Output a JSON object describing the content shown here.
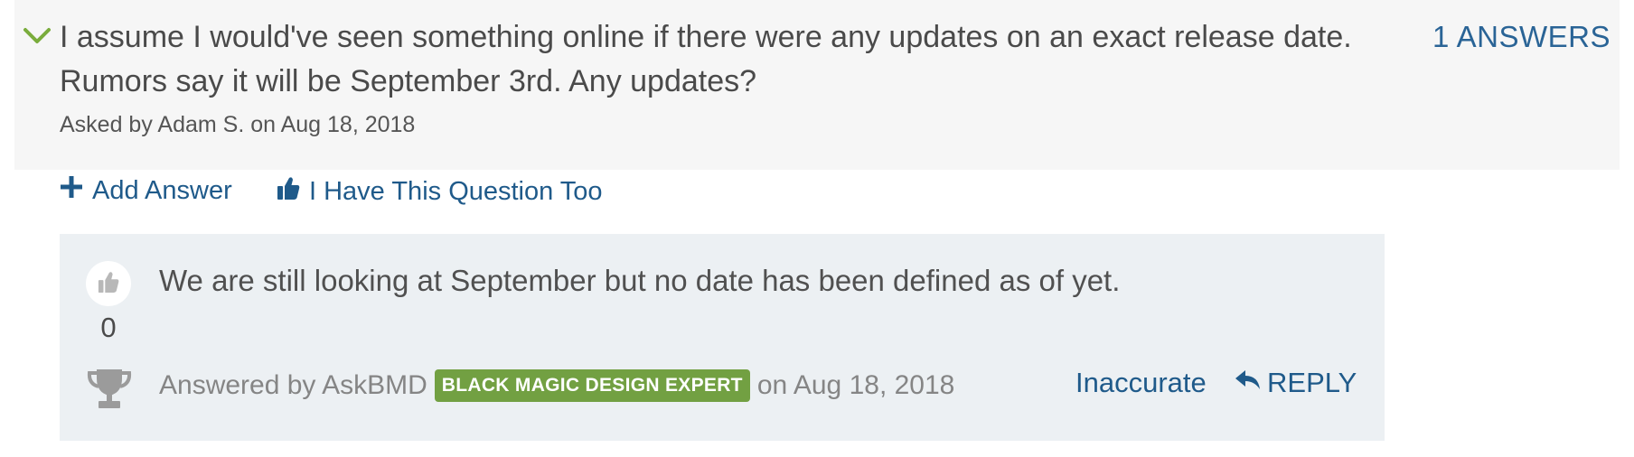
{
  "question": {
    "text": "I assume I would've seen something online if there were any updates on an exact release date. Rumors say it will be September 3rd. Any updates?",
    "asked_line": "Asked by Adam S. on Aug 18, 2018",
    "answers_count": "1 ANSWERS"
  },
  "actions": {
    "add_answer": "Add Answer",
    "have_question": "I Have This Question Too"
  },
  "answer": {
    "text": "We are still looking at September but no date has been defined as of yet.",
    "votes": "0",
    "answered_by": "Answered by AskBMD",
    "badge": "BLACK MAGIC DESIGN EXPERT",
    "date": "on Aug 18, 2018",
    "inaccurate": "Inaccurate",
    "reply": "REPLY"
  },
  "icons": {
    "expand": "chevron-down-icon",
    "add": "plus-icon",
    "thumbs": "thumbs-up-icon",
    "trophy": "trophy-icon",
    "reply": "reply-arrow-icon"
  },
  "colors": {
    "link": "#1f5a8a",
    "badge_bg": "#72a042",
    "chevron": "#7aac3c",
    "question_bg": "#f6f6f6",
    "answer_bg": "#ecf0f3"
  }
}
